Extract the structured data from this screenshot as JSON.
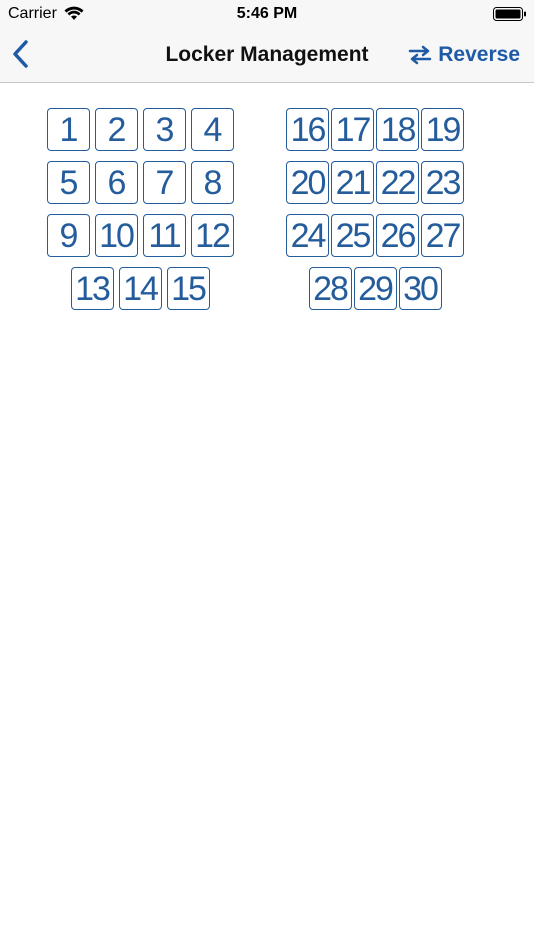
{
  "status": {
    "carrier": "Carrier",
    "time": "5:46 PM"
  },
  "nav": {
    "title": "Locker Management",
    "reverse_label": "Reverse"
  },
  "lockers": {
    "left": [
      [
        "1",
        "2",
        "3",
        "4"
      ],
      [
        "5",
        "6",
        "7",
        "8"
      ],
      [
        "9",
        "10",
        "11",
        "12"
      ],
      [
        "13",
        "14",
        "15"
      ]
    ],
    "right": [
      [
        "16",
        "17",
        "18",
        "19"
      ],
      [
        "20",
        "21",
        "22",
        "23"
      ],
      [
        "24",
        "25",
        "26",
        "27"
      ],
      [
        "28",
        "29",
        "30"
      ]
    ]
  },
  "colors": {
    "accent": "#245c9c",
    "nav_bg": "#f7f7f7"
  }
}
